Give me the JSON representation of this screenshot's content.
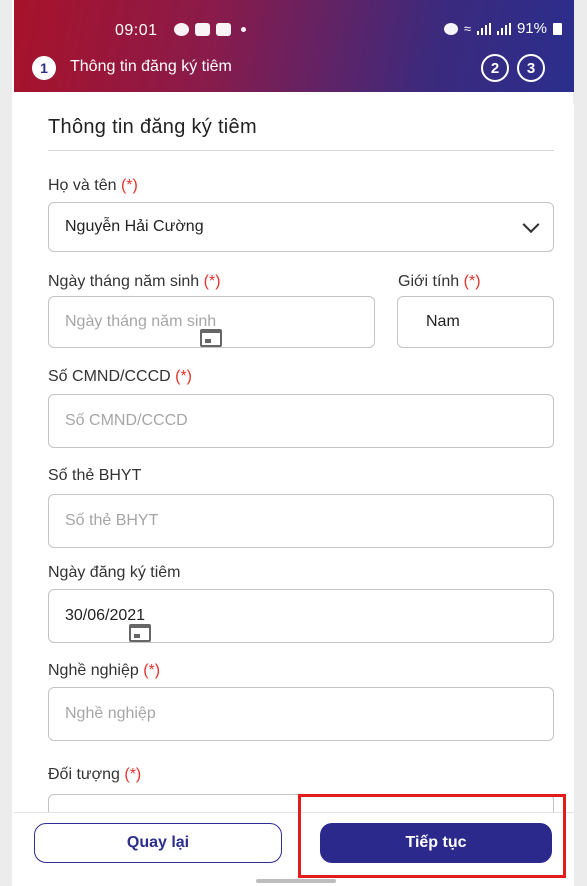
{
  "status_bar": {
    "time": "09:01",
    "battery": "91%"
  },
  "stepper": {
    "active_step": "1",
    "title": "Thông tin đăng ký tiêm",
    "step_2": "2",
    "step_3": "3"
  },
  "form": {
    "section_title": "Thông tin đăng ký tiêm",
    "required_mark": "(*)",
    "full_name": {
      "label": "Họ và tên",
      "value": "Nguyễn Hải Cường"
    },
    "dob": {
      "label": "Ngày tháng năm sinh",
      "placeholder": "Ngày tháng năm sinh"
    },
    "gender": {
      "label": "Giới tính",
      "value": "Nam"
    },
    "id_number": {
      "label": "Số CMND/CCCD",
      "placeholder": "Số CMND/CCCD"
    },
    "insurance": {
      "label": "Số thẻ BHYT",
      "placeholder": "Số thẻ BHYT"
    },
    "register_date": {
      "label": "Ngày đăng ký tiêm",
      "value": "30/06/2021"
    },
    "occupation": {
      "label": "Nghề nghiệp",
      "placeholder": "Nghề nghiệp"
    },
    "target_group": {
      "label": "Đối tượng"
    }
  },
  "footer": {
    "back_label": "Quay lại",
    "next_label": "Tiếp tục"
  },
  "colors": {
    "primary": "#2b2a8c",
    "required": "#e5322d",
    "highlight": "#e21b1b"
  }
}
